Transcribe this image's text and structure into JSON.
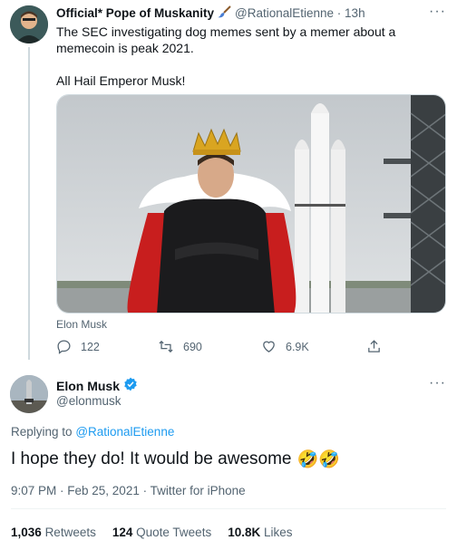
{
  "parent": {
    "name": "Official* Pope of Muskanity",
    "handle_time": "@RationalEtienne · 13h",
    "text_line1": "The SEC investigating dog memes sent by a memer about a memecoin is peak 2021.",
    "text_line2": "All Hail Emperor Musk!",
    "media_caption": "Elon Musk",
    "replies": "122",
    "retweets": "690",
    "likes": "6.9K"
  },
  "main": {
    "name": "Elon Musk",
    "handle": "@elonmusk",
    "replying_to_label": "Replying to",
    "replying_to_handle": "@RationalEtienne",
    "text": "I hope they do! It would be awesome",
    "emoji": "🤣🤣",
    "meta": "9:07 PM · Feb 25, 2021 · Twitter for iPhone",
    "stats": {
      "retweets_count": "1,036",
      "retweets_label": "Retweets",
      "quotes_count": "124",
      "quotes_label": "Quote Tweets",
      "likes_count": "10.8K",
      "likes_label": "Likes"
    }
  },
  "colors": {
    "accent": "#1d9bf0",
    "secondary_text": "#536471",
    "primary_text": "#0f1419"
  },
  "icons": [
    "brush-icon",
    "more-icon",
    "reply-icon",
    "retweet-icon",
    "like-icon",
    "share-icon",
    "verified-icon"
  ]
}
